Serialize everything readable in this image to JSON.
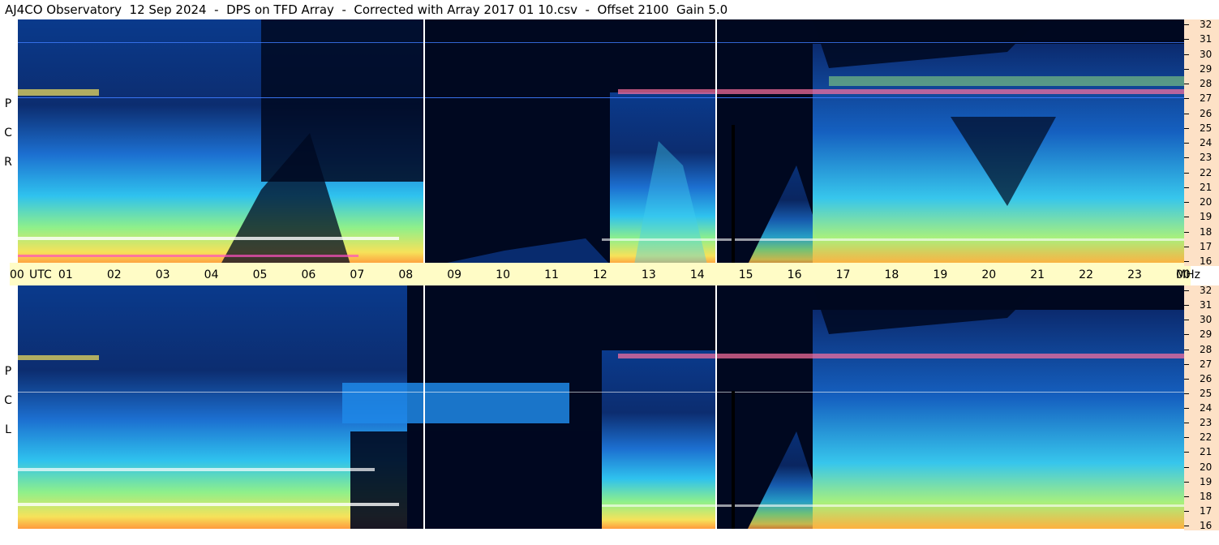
{
  "title": "AJ4CO Observatory  12 Sep 2024  -  DPS on TFD Array  -  Corrected with Array 2017 01 10.csv  -  Offset 2100  Gain 5.0",
  "top_panel": {
    "polarization_letters": [
      "R",
      "C",
      "P"
    ]
  },
  "bottom_panel": {
    "polarization_letters": [
      "L",
      "C",
      "P"
    ]
  },
  "time_axis": {
    "labels": [
      "00",
      "UTC",
      "01",
      "02",
      "03",
      "04",
      "05",
      "06",
      "07",
      "08",
      "09",
      "10",
      "11",
      "12",
      "13",
      "14",
      "15",
      "16",
      "17",
      "18",
      "19",
      "20",
      "21",
      "22",
      "23",
      "00",
      "MHz"
    ],
    "hours": [
      "00",
      "01",
      "02",
      "03",
      "04",
      "05",
      "06",
      "07",
      "08",
      "09",
      "10",
      "11",
      "12",
      "13",
      "14",
      "15",
      "16",
      "17",
      "18",
      "19",
      "20",
      "21",
      "22",
      "23",
      "00"
    ],
    "unit_utc": "UTC",
    "unit_mhz": "MHz"
  },
  "frequency_axis": {
    "labels": [
      "32",
      "31",
      "30",
      "29",
      "28",
      "27",
      "26",
      "25",
      "24",
      "23",
      "22",
      "21",
      "20",
      "19",
      "18",
      "17",
      "16"
    ]
  },
  "colors": {
    "background_dark": "#000820",
    "axis_time_bg": "#fffcc6",
    "axis_freq_bg": "#fde1c6",
    "divider": "#ffffff"
  }
}
